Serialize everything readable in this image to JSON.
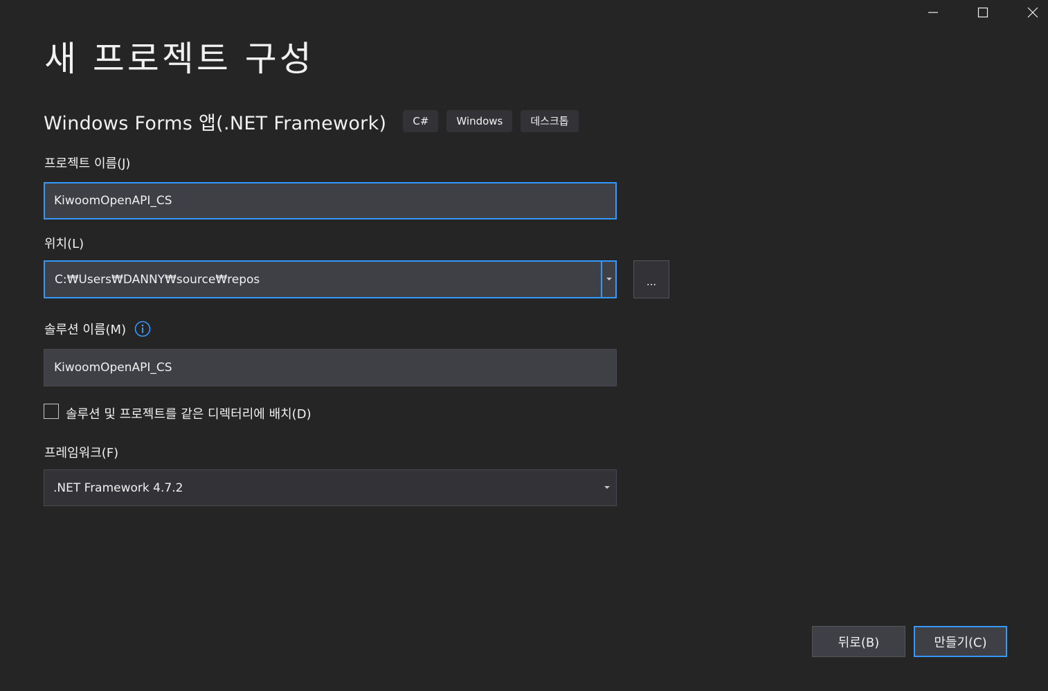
{
  "window": {
    "controls": {
      "minimize": "minimize-icon",
      "maximize": "maximize-icon",
      "close": "close-icon"
    }
  },
  "page": {
    "title": "새 프로젝트 구성"
  },
  "template": {
    "name": "Windows Forms 앱(.NET Framework)",
    "tags": [
      "C#",
      "Windows",
      "데스크톱"
    ]
  },
  "project_name": {
    "label": "프로젝트 이름(J)",
    "value": "KiwoomOpenAPI_CS"
  },
  "location": {
    "label": "위치(L)",
    "value": "C:₩Users₩DANNY₩source₩repos",
    "browse_label": "..."
  },
  "solution_name": {
    "label": "솔루션 이름(M)",
    "value": "KiwoomOpenAPI_CS",
    "info_icon": "info-icon"
  },
  "same_directory": {
    "label": "솔루션 및 프로젝트를 같은 디렉터리에 배치(D)",
    "checked": false
  },
  "framework": {
    "label": "프레임워크(F)",
    "selected": ".NET Framework 4.7.2"
  },
  "buttons": {
    "back": "뒤로(B)",
    "create": "만들기(C)"
  },
  "colors": {
    "background": "#252526",
    "accent": "#3399ff",
    "input_bg": "#3f3f46",
    "text": "#f1f1f1"
  }
}
